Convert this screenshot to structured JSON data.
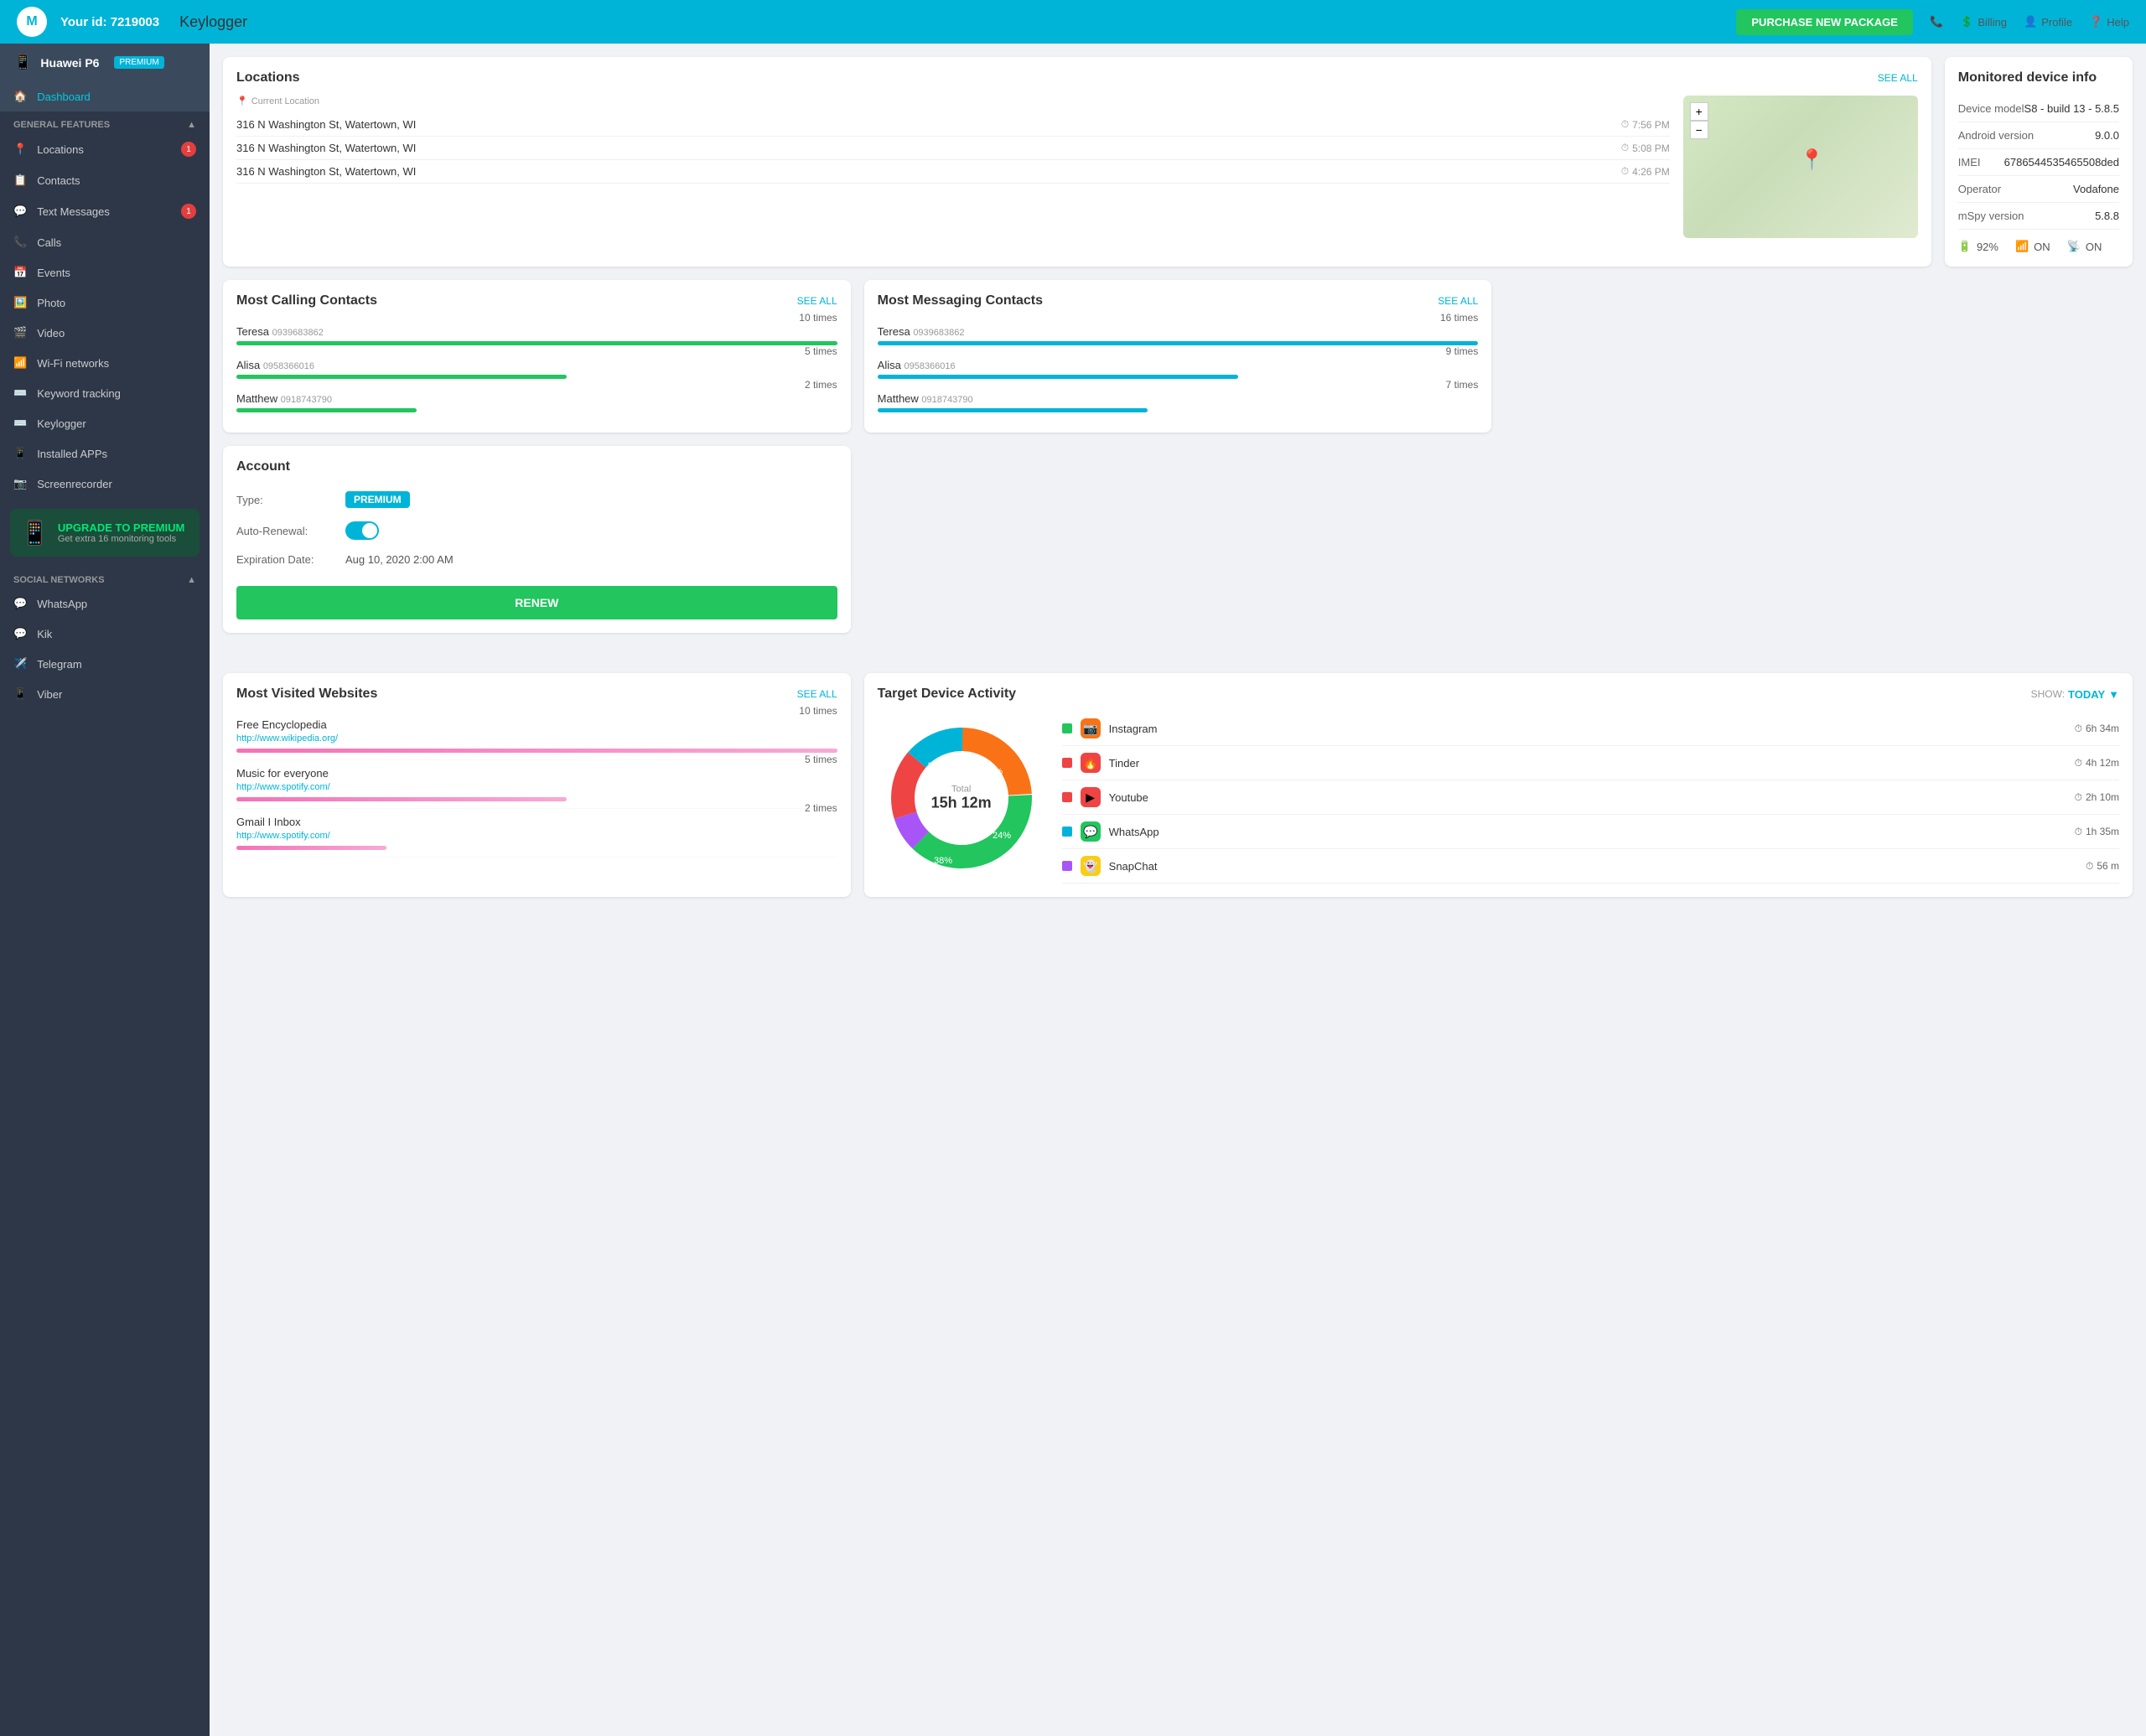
{
  "topNav": {
    "logoText": "M",
    "userId": "Your id: 7219003",
    "pageTitle": "Keylogger",
    "purchaseBtn": "PURCHASE NEW PACKAGE",
    "navItems": [
      {
        "label": "Billing",
        "icon": "💲"
      },
      {
        "label": "Profile",
        "icon": "👤"
      },
      {
        "label": "Help",
        "icon": "❓"
      }
    ]
  },
  "sidebar": {
    "deviceName": "Huawei P6",
    "premiumBadge": "PREMIUM",
    "activeItem": "Dashboard",
    "generalSection": "GENERAL FEATURES",
    "navItems": [
      {
        "label": "Dashboard",
        "icon": "🏠",
        "active": true,
        "badge": null
      },
      {
        "label": "Locations",
        "icon": "📍",
        "active": false,
        "badge": "1"
      },
      {
        "label": "Contacts",
        "icon": "📋",
        "active": false,
        "badge": null
      },
      {
        "label": "Text Messages",
        "icon": "💬",
        "active": false,
        "badge": "1"
      },
      {
        "label": "Calls",
        "icon": "📞",
        "active": false,
        "badge": null
      },
      {
        "label": "Events",
        "icon": "📅",
        "active": false,
        "badge": null
      },
      {
        "label": "Photo",
        "icon": "🖼️",
        "active": false,
        "badge": null
      },
      {
        "label": "Video",
        "icon": "🎬",
        "active": false,
        "badge": null
      },
      {
        "label": "Wi-Fi networks",
        "icon": "📶",
        "active": false,
        "badge": null
      },
      {
        "label": "Keyword tracking",
        "icon": "⌨️",
        "active": false,
        "badge": null
      },
      {
        "label": "Keylogger",
        "icon": "⌨️",
        "active": false,
        "badge": null
      },
      {
        "label": "Installed APPs",
        "icon": "📱",
        "active": false,
        "badge": null
      },
      {
        "label": "Screenrecorder",
        "icon": "📷",
        "active": false,
        "badge": null
      }
    ],
    "socialSection": "SOCIAL NETWORKS",
    "socialItems": [
      {
        "label": "WhatsApp",
        "icon": "💬"
      },
      {
        "label": "Kik",
        "icon": "💬"
      },
      {
        "label": "Telegram",
        "icon": "✈️"
      },
      {
        "label": "Viber",
        "icon": "📱"
      }
    ],
    "upgradeBanner": {
      "title": "UPGRADE TO PREMIUM",
      "sub": "Get extra 16 monitoring tools"
    }
  },
  "locations": {
    "title": "Locations",
    "seeAll": "SEE ALL",
    "currentLocation": "Current Location",
    "entries": [
      {
        "address": "316 N Washington St, Watertown, WI",
        "time": "7:56 PM"
      },
      {
        "address": "316 N Washington St, Watertown, WI",
        "time": "5:08 PM"
      },
      {
        "address": "316 N Washington St, Watertown, WI",
        "time": "4:26 PM"
      }
    ],
    "mapZoomIn": "+",
    "mapZoomOut": "−"
  },
  "deviceInfo": {
    "title": "Monitored device info",
    "rows": [
      {
        "label": "Device model",
        "value": "S8 - build 13 - 5.8.5"
      },
      {
        "label": "Android version",
        "value": "9.0.0"
      },
      {
        "label": "IMEI",
        "value": "6786544535465508ded"
      },
      {
        "label": "Operator",
        "value": "Vodafone"
      },
      {
        "label": "mSpy version",
        "value": "5.8.8"
      }
    ],
    "battery": "92%",
    "wifi": "ON",
    "signal": "ON"
  },
  "account": {
    "title": "Account",
    "typeLabel": "Type:",
    "typeValue": "PREMIUM",
    "autoRenewalLabel": "Auto-Renewal:",
    "expiryLabel": "Expiration Date:",
    "expiryValue": "Aug 10, 2020 2:00 AM",
    "renewBtn": "RENEW"
  },
  "mostCalling": {
    "title": "Most Calling Contacts",
    "seeAll": "SEE ALL",
    "contacts": [
      {
        "name": "Teresa",
        "phone": "0939683862",
        "times": "10 times",
        "barWidth": "100%",
        "barColor": "#22c55e"
      },
      {
        "name": "Alisa",
        "phone": "0958366016",
        "times": "5 times",
        "barWidth": "55%",
        "barColor": "#22c55e"
      },
      {
        "name": "Matthew",
        "phone": "0918743790",
        "times": "2 times",
        "barWidth": "30%",
        "barColor": "#22c55e"
      }
    ]
  },
  "mostMessaging": {
    "title": "Most Messaging Contacts",
    "seeAll": "SEE ALL",
    "contacts": [
      {
        "name": "Teresa",
        "phone": "0939683862",
        "times": "16 times",
        "barWidth": "100%",
        "barColor": "#00b4d8"
      },
      {
        "name": "Alisa",
        "phone": "0958366016",
        "times": "9 times",
        "barWidth": "60%",
        "barColor": "#00b4d8"
      },
      {
        "name": "Matthew",
        "phone": "0918743790",
        "times": "7 times",
        "barWidth": "45%",
        "barColor": "#00b4d8"
      }
    ]
  },
  "websites": {
    "title": "Most Visited Websites",
    "seeAll": "SEE ALL",
    "entries": [
      {
        "name": "Free Encyclopedia",
        "url": "http://www.wikipedia.org/",
        "times": "10 times",
        "barWidth": "100%"
      },
      {
        "name": "Music for everyone",
        "url": "http://www.spotify.com/",
        "times": "5 times",
        "barWidth": "55%"
      },
      {
        "name": "Gmail I Inbox",
        "url": "http://www.spotify.com/",
        "times": "2 times",
        "barWidth": "25%"
      }
    ]
  },
  "activity": {
    "title": "Target Device Activity",
    "showLabel": "SHOW:",
    "showValue": "TODAY",
    "totalLabel": "Total",
    "totalValue": "15h 12m",
    "donutSegments": [
      {
        "label": "Instagram",
        "percent": 24,
        "color": "#f97316"
      },
      {
        "label": "WhatsApp",
        "percent": 38,
        "color": "#22c55e"
      },
      {
        "label": "SnapChat",
        "percent": 8,
        "color": "#a855f7"
      },
      {
        "label": "Youtube",
        "percent": 16,
        "color": "#ef4444"
      },
      {
        "label": "Tinder",
        "percent": 14,
        "color": "#00b4d8"
      }
    ],
    "apps": [
      {
        "name": "Instagram",
        "time": "6h 34m",
        "color": "#f97316",
        "icon": "📷",
        "dotColor": "#22c55e"
      },
      {
        "name": "Tinder",
        "time": "4h 12m",
        "color": "#ef4444",
        "icon": "🔥",
        "dotColor": "#ef4444"
      },
      {
        "name": "Youtube",
        "time": "2h 10m",
        "color": "#ef4444",
        "icon": "▶️",
        "dotColor": "#ef4444"
      },
      {
        "name": "WhatsApp",
        "time": "1h 35m",
        "color": "#22c55e",
        "icon": "💬",
        "dotColor": "#00b4d8"
      },
      {
        "name": "SnapChat",
        "time": "56 m",
        "color": "#a855f7",
        "icon": "👻",
        "dotColor": "#a855f7"
      }
    ]
  }
}
